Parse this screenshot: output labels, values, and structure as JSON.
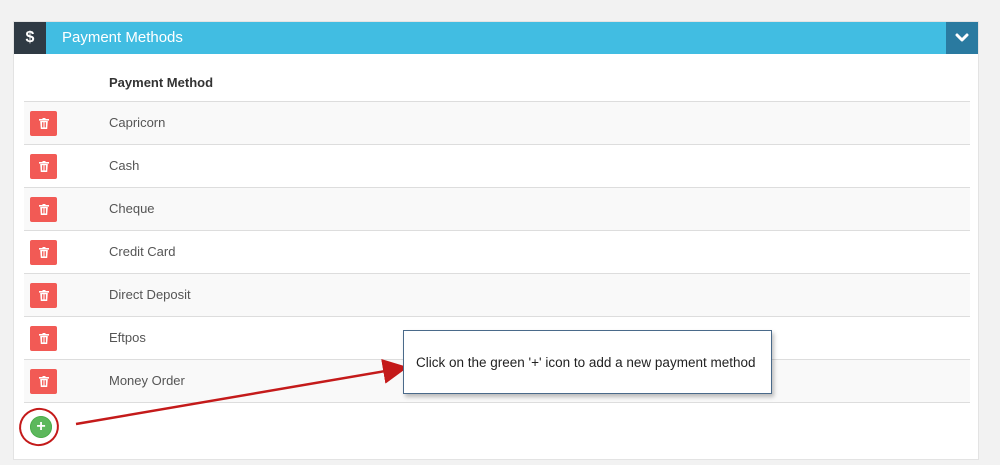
{
  "panel": {
    "header_icon": "$",
    "title": "Payment Methods",
    "collapse_icon": "chevron-down-icon"
  },
  "table": {
    "column_header": "Payment Method",
    "rows": [
      {
        "label": "Capricorn"
      },
      {
        "label": "Cash"
      },
      {
        "label": "Cheque"
      },
      {
        "label": "Credit Card"
      },
      {
        "label": "Direct Deposit"
      },
      {
        "label": "Eftpos"
      },
      {
        "label": "Money Order"
      }
    ]
  },
  "add_button": {
    "label": "+"
  },
  "callout": {
    "text": "Click on the green '+' icon to add a new payment method"
  },
  "colors": {
    "header": "#41bde2",
    "header_icon_bg": "#2f3a44",
    "collapse_bg": "#2a7aa0",
    "delete_button": "#f25a55",
    "add_button": "#5cb85c",
    "annotation": "#c41a1a"
  }
}
